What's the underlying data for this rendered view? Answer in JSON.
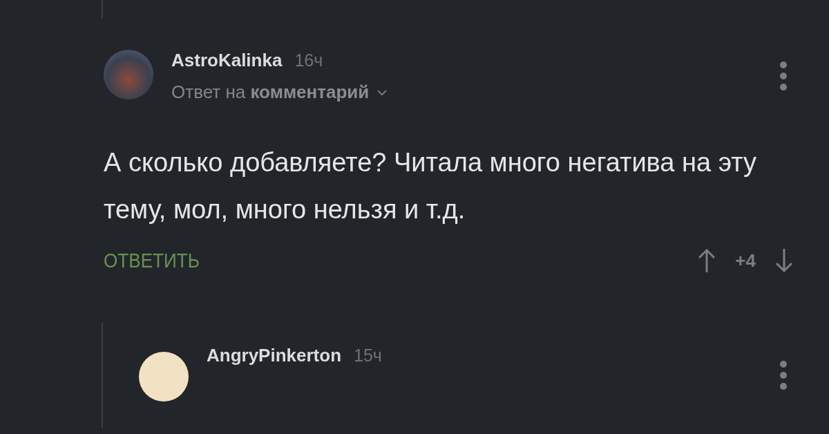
{
  "comments": [
    {
      "author": "AstroKalinka",
      "time": "16ч",
      "reply_to": "Ответ на **комментарий**",
      "text": "А сколько добавляете? Читала много негатива на эту тему, мол, много нельзя и т.д.",
      "reply_button": "ОТВЕТИТЬ",
      "rating": "+4"
    },
    {
      "author": "AngryPinkerton",
      "time": "15ч"
    }
  ]
}
